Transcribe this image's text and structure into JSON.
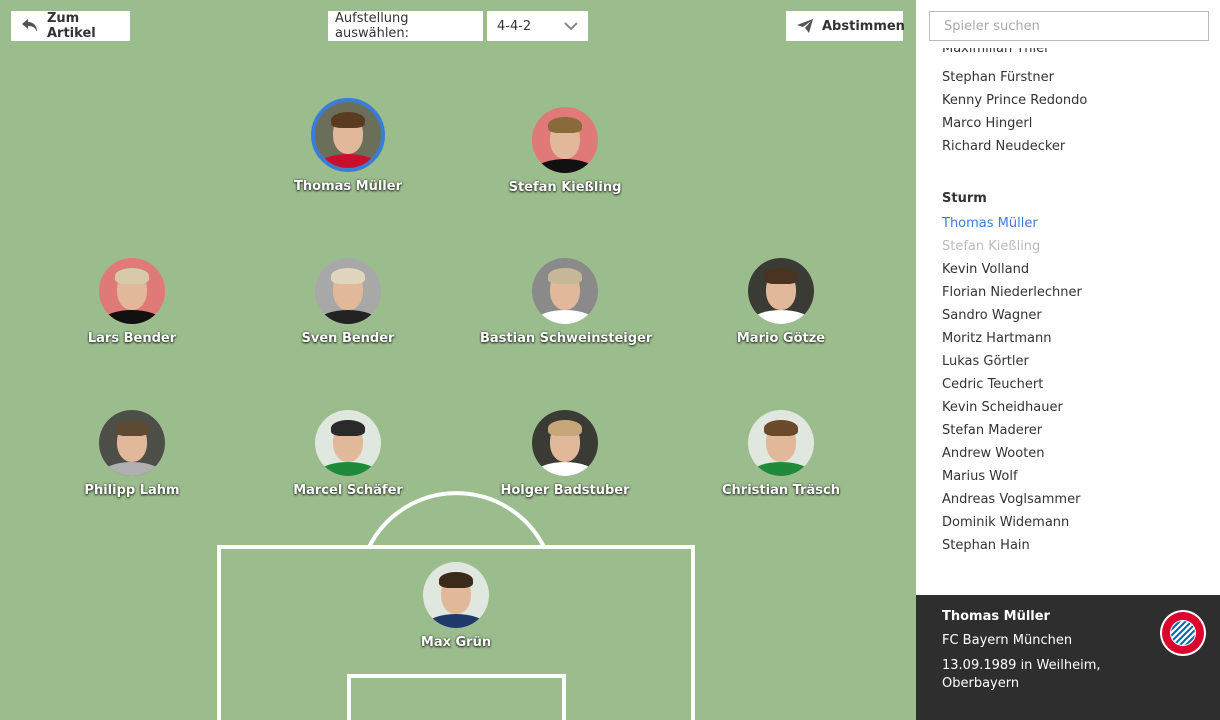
{
  "toolbar": {
    "back_label": "Zum Artikel",
    "formation_label": "Aufstellung auswählen:",
    "formation_value": "4-4-2",
    "vote_label": "Abstimmen"
  },
  "pitch": {
    "players": [
      {
        "name": "Thomas Müller",
        "selected": true,
        "bg": "#6b6f5a"
      },
      {
        "name": "Stefan Kießling",
        "selected": false,
        "bg": "#e07a78"
      },
      {
        "name": "Lars Bender",
        "selected": false,
        "bg": "#e07a78"
      },
      {
        "name": "Sven Bender",
        "selected": false,
        "bg": "#a8a8a8"
      },
      {
        "name": "Bastian Schweinsteiger",
        "selected": false,
        "bg": "#8a8a8a"
      },
      {
        "name": "Mario Götze",
        "selected": false,
        "bg": "#3b3b36"
      },
      {
        "name": "Philipp Lahm",
        "selected": false,
        "bg": "#4e4e48"
      },
      {
        "name": "Marcel Schäfer",
        "selected": false,
        "bg": "#dfe7df"
      },
      {
        "name": "Holger Badstuber",
        "selected": false,
        "bg": "#3b3b36"
      },
      {
        "name": "Christian Träsch",
        "selected": false,
        "bg": "#dfe7df"
      },
      {
        "name": "Max Grün",
        "selected": false,
        "bg": "#dfe7df"
      }
    ]
  },
  "sidebar": {
    "search_placeholder": "Spieler suchen",
    "partial_item": "Maximilian Thiel",
    "items_top": [
      "Stephan Fürstner",
      "Kenny Prince Redondo",
      "Marco Hingerl",
      "Richard Neudecker"
    ],
    "section_title": "Sturm",
    "selected_item": "Thomas Müller",
    "disabled_item": "Stefan Kießling",
    "items_sturm": [
      "Kevin Volland",
      "Florian Niederlechner",
      "Sandro Wagner",
      "Moritz Hartmann",
      "Lukas Görtler",
      "Cedric Teuchert",
      "Kevin Scheidhauer",
      "Stefan Maderer",
      "Andrew Wooten",
      "Marius Wolf",
      "Andreas Voglsammer",
      "Dominik Widemann",
      "Stephan Hain"
    ]
  },
  "info": {
    "name": "Thomas Müller",
    "club": "FC Bayern München",
    "birth": "13.09.1989 in Weilheim, Oberbayern",
    "logo_text": "FC BAYERN MÜNCHEN"
  },
  "colors": {
    "pitch": "#9bbd8d",
    "accent": "#3a7dd6",
    "info_bg": "#2e2e2e",
    "bayern_red": "#dc052d",
    "bayern_blue": "#0066b2"
  }
}
